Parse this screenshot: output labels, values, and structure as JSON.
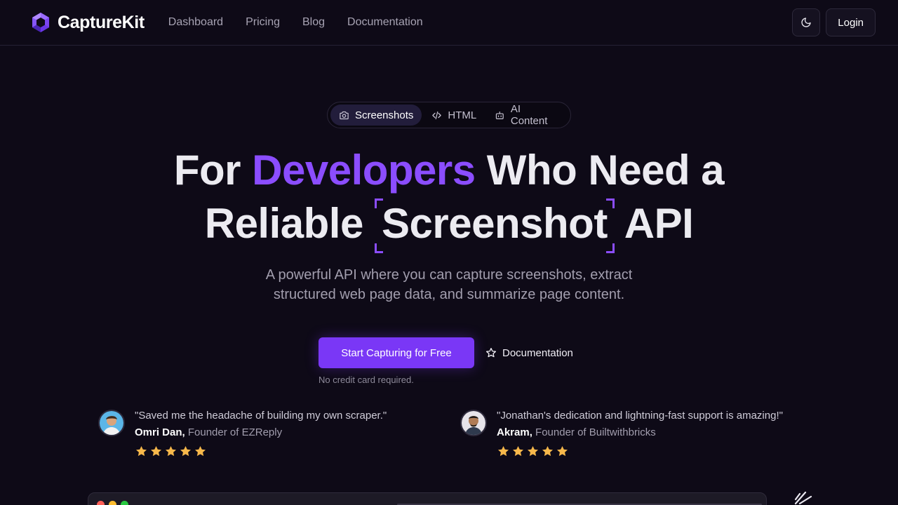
{
  "brand": {
    "name": "CaptureKit",
    "accent": "#8b4dff",
    "cta_color": "#7a37f6",
    "background": "#0e0a17"
  },
  "nav": {
    "links": [
      "Dashboard",
      "Pricing",
      "Blog",
      "Documentation"
    ],
    "theme_icon": "moon-icon",
    "login_label": "Login"
  },
  "tabs": [
    {
      "label": "Screenshots",
      "icon": "camera-icon",
      "active": true
    },
    {
      "label": "HTML",
      "icon": "code-icon",
      "active": false
    },
    {
      "label": "AI Content",
      "icon": "robot-icon",
      "active": false
    }
  ],
  "hero": {
    "line1_pre": "For ",
    "line1_accent": "Developers",
    "line1_post": " Who Need a",
    "line2_pre": "Reliable ",
    "line2_bracketed": "Screenshot",
    "line2_post": " API",
    "subtitle": "A powerful API where you can capture screenshots, extract structured web page data, and summarize page content."
  },
  "cta": {
    "primary_label": "Start Capturing for Free",
    "secondary_label": "Documentation",
    "secondary_icon": "star-icon",
    "note": "No credit card required."
  },
  "testimonials": [
    {
      "quote": "\"Saved me the headache of building my own scraper.\"",
      "name": "Omri Dan,",
      "role": "Founder of EZReply",
      "rating": 5
    },
    {
      "quote": "\"Jonathan's dedication and lightning-fast support is amazing!\"",
      "name": "Akram,",
      "role": "Founder of Builtwithbricks",
      "rating": 5
    }
  ],
  "star_color": "#f7b84b"
}
